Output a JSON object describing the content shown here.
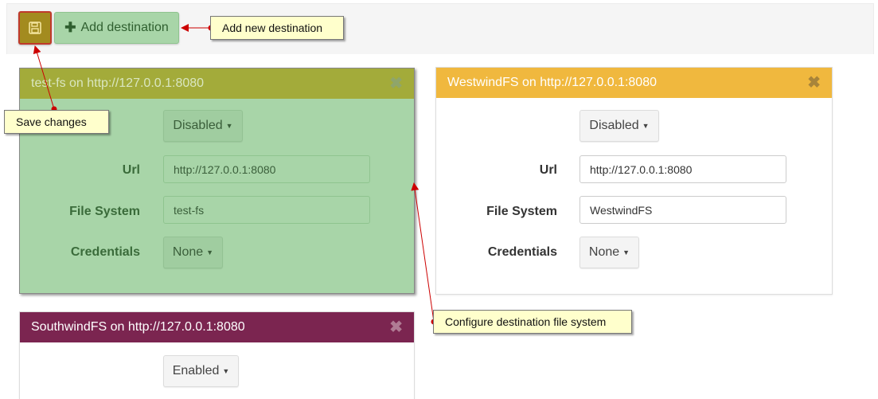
{
  "toolbar": {
    "save_icon": "floppy-disk-icon",
    "add_label": "Add destination",
    "add_icon": "plus-icon"
  },
  "callouts": {
    "add_new": "Add new destination",
    "save_changes": "Save changes",
    "configure": "Configure destination file system"
  },
  "panels": [
    {
      "title": "test-fs on http://127.0.0.1:8080",
      "status": "Disabled",
      "url_label": "Url",
      "url_value": "http://127.0.0.1:8080",
      "fs_label": "File System",
      "fs_value": "test-fs",
      "cred_label": "Credentials",
      "cred_value": "None",
      "heading_color": "#a3ab3a"
    },
    {
      "title": "WestwindFS on http://127.0.0.1:8080",
      "status": "Disabled",
      "url_label": "Url",
      "url_value": "http://127.0.0.1:8080",
      "fs_label": "File System",
      "fs_value": "WestwindFS",
      "cred_label": "Credentials",
      "cred_value": "None",
      "heading_color": "#f0b83e"
    },
    {
      "title": "SouthwindFS on http://127.0.0.1:8080",
      "status": "Enabled",
      "heading_color": "#7b2550"
    }
  ],
  "close_glyph": "✖"
}
